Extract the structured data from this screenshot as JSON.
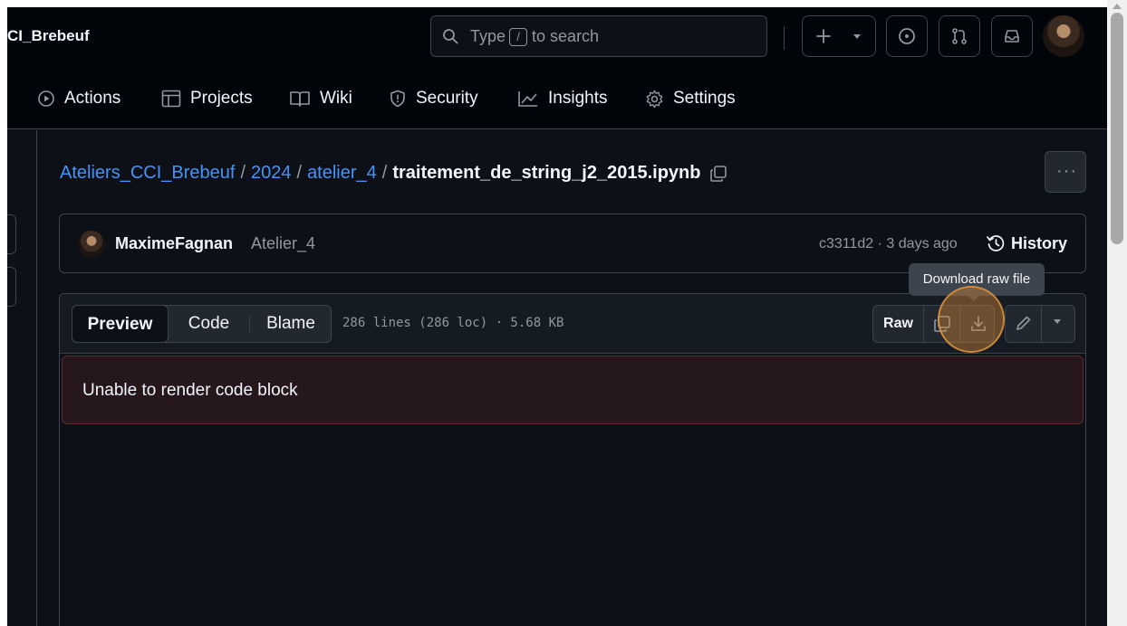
{
  "header": {
    "repo_title": "CI_Brebeuf",
    "search_prefix": "Type",
    "search_key": "/",
    "search_suffix": "to search"
  },
  "repo_nav": {
    "actions": "Actions",
    "projects": "Projects",
    "wiki": "Wiki",
    "security": "Security",
    "insights": "Insights",
    "settings": "Settings"
  },
  "breadcrumb": {
    "root": "Ateliers_CCI_Brebeuf",
    "sep": "/",
    "year": "2024",
    "folder": "atelier_4",
    "file": "traitement_de_string_j2_2015.ipynb"
  },
  "commit": {
    "author": "MaximeFagnan",
    "message": "Atelier_4",
    "meta": "c3311d2 · 3 days ago",
    "history_label": "History"
  },
  "file": {
    "tabs": {
      "preview": "Preview",
      "code": "Code",
      "blame": "Blame"
    },
    "info": "286 lines (286 loc) · 5.68 KB",
    "raw_label": "Raw",
    "error_message": "Unable to render code block"
  },
  "tooltip": {
    "text": "Download raw file"
  },
  "colors": {
    "background": "#0d1117",
    "header": "#010409",
    "link": "#4493f8",
    "border": "#3d444d",
    "error_bg": "#25171c",
    "highlight": "#d68938"
  }
}
